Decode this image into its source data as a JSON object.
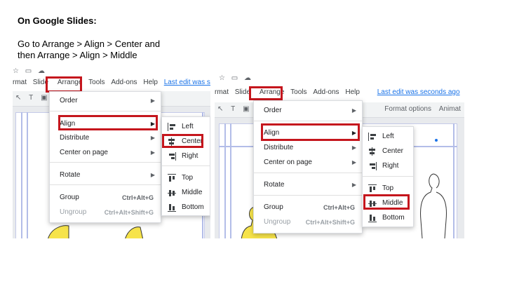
{
  "heading": "On Google Slides:",
  "instruction": {
    "line1": "Go to Arrange > Align > Center and",
    "line2": "then Arrange > Align > Middle"
  },
  "colors": {
    "highlight": "#c5161d",
    "link": "#1a73e8",
    "guide": "#b3bde8"
  },
  "shot1": {
    "menubar": [
      "rmat",
      "Slide",
      "Arrange",
      "Tools",
      "Add-ons",
      "Help"
    ],
    "last_edit": "Last edit was second",
    "menu": {
      "items": [
        "Order",
        "Align",
        "Distribute",
        "Center on page",
        "Rotate",
        "Group",
        "Ungroup"
      ],
      "shortcuts": {
        "group": "Ctrl+Alt+G",
        "ungroup": "Ctrl+Alt+Shift+G"
      }
    },
    "submenu": [
      "Left",
      "Center",
      "Right",
      "Top",
      "Middle",
      "Bottom"
    ]
  },
  "shot2": {
    "menubar": [
      "rmat",
      "Slide",
      "Arrange",
      "Tools",
      "Add-ons",
      "Help"
    ],
    "last_edit": "Last edit was seconds ago",
    "toolbar": {
      "format_options": "Format options",
      "animate": "Animat"
    },
    "menu": {
      "items": [
        "Order",
        "Align",
        "Distribute",
        "Center on page",
        "Rotate",
        "Group",
        "Ungroup"
      ],
      "shortcuts": {
        "group": "Ctrl+Alt+G",
        "ungroup": "Ctrl+Alt+Shift+G"
      }
    },
    "submenu": [
      "Left",
      "Center",
      "Right",
      "Top",
      "Middle",
      "Bottom"
    ]
  }
}
